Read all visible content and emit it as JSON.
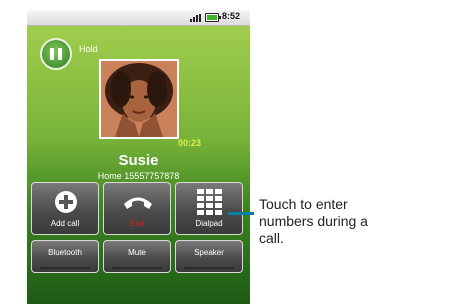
{
  "status_bar": {
    "time": "8:52",
    "icons": [
      "signal-icon",
      "battery-icon"
    ],
    "battery_color": "#3fb327"
  },
  "call": {
    "hold_label": "Hold",
    "duration": "00:23",
    "contact_name": "Susie",
    "contact_number": "Home 15557757878"
  },
  "buttons": {
    "add_call": "Add call",
    "end": "End",
    "dialpad": "Dialpad",
    "bluetooth": "Bluetooth",
    "mute": "Mute",
    "speaker": "Speaker"
  },
  "icons": {
    "hold": "pause-icon",
    "add_call": "plus-icon",
    "end": "phone-hangup-icon",
    "dialpad": "dialpad-icon"
  },
  "colors": {
    "end_label": "#e2231a",
    "timer": "#d8f14a",
    "callout_line": "#0a7fa8",
    "screen_top": "#a0cd4c",
    "screen_bottom": "#1d5b14"
  },
  "callout": {
    "text": "Touch to enter numbers during a call."
  }
}
